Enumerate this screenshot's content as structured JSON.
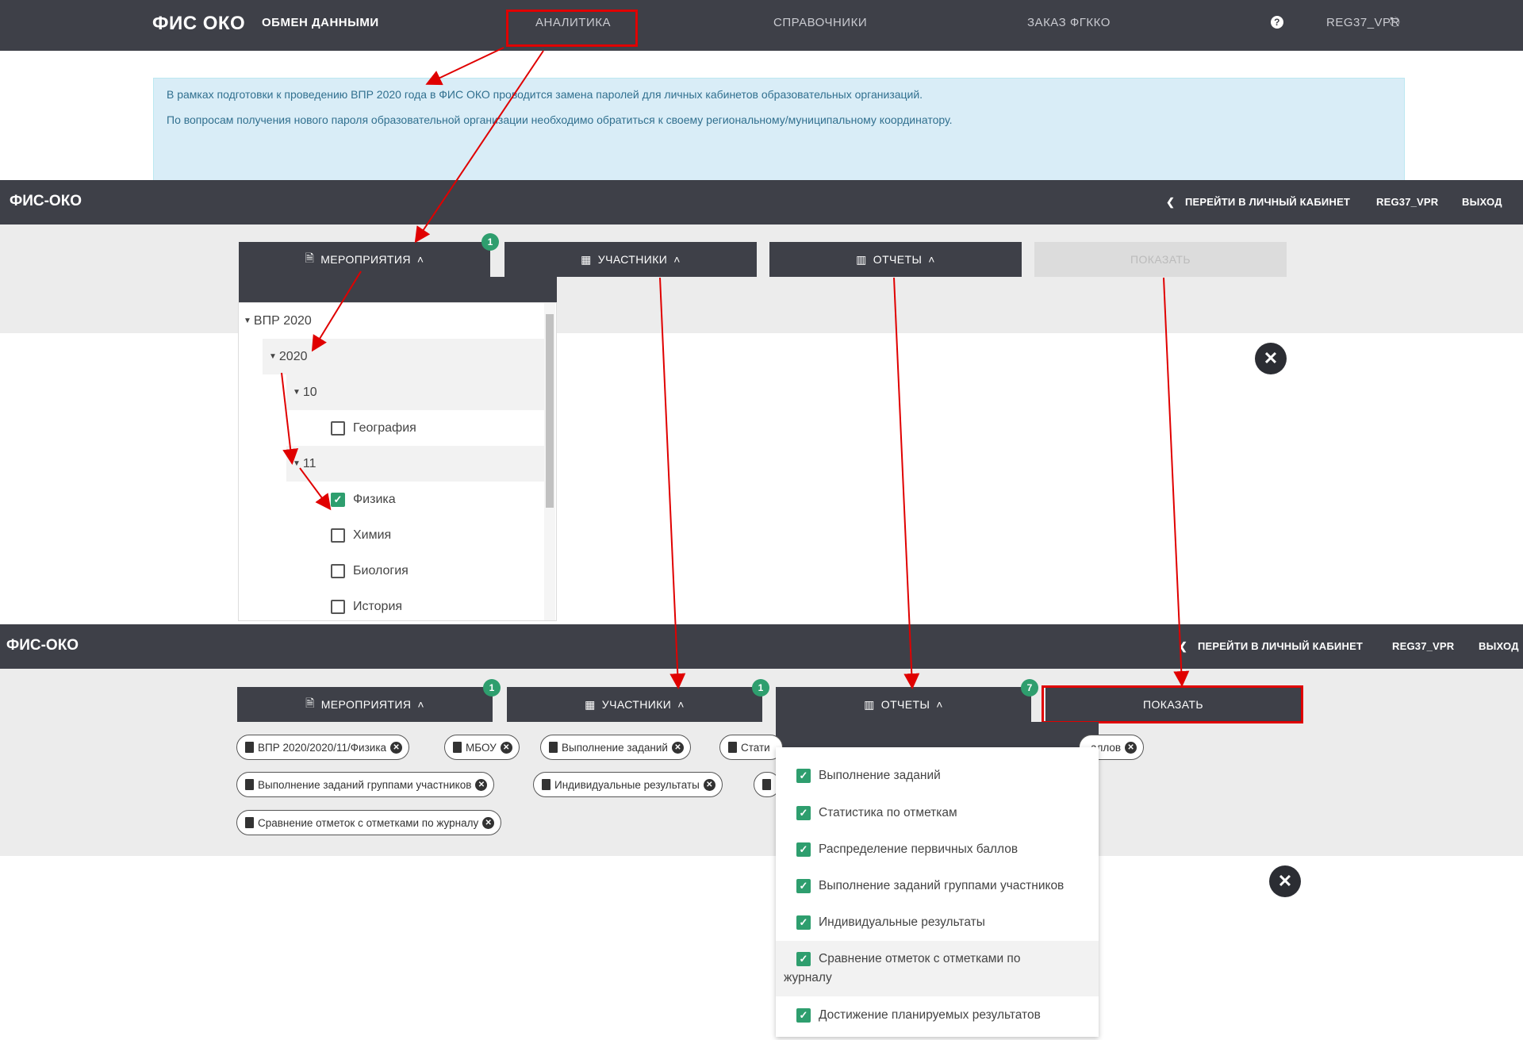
{
  "top_nav": {
    "brand": "ФИС ОКО",
    "items": [
      "ОБМЕН ДАННЫМИ",
      "АНАЛИТИКА",
      "СПРАВОЧНИКИ",
      "ЗАКАЗ ФГККО"
    ],
    "user": "REG37_VPR",
    "help_icon": "question-circle-icon",
    "logout_icon": "logout-icon"
  },
  "alert": {
    "line1": "В рамках подготовки к проведению ВПР 2020 года в ФИС ОКО проводится замена паролей для личных кабинетов образовательных организаций.",
    "line2": "По вопросам получения нового пароля образовательной организации необходимо обратиться к своему региональному/муниципальному координатору."
  },
  "header": {
    "logo": "ФИС-ОКО",
    "cabinet_link": "ПЕРЕЙТИ В ЛИЧНЫЙ КАБИНЕТ",
    "user": "REG37_VPR",
    "logout": "ВЫХОД"
  },
  "tabs": {
    "events": "МЕРОПРИЯТИЯ",
    "participants": "УЧАСТНИКИ",
    "reports": "ОТЧЕТЫ",
    "show": "ПОКАЗАТЬ"
  },
  "panel1": {
    "events_badge": "1",
    "tree": [
      {
        "label": "ВПР 2020",
        "type": "node"
      },
      {
        "label": "2020",
        "type": "node"
      },
      {
        "label": "10",
        "type": "node"
      },
      {
        "label": "География",
        "type": "leaf",
        "checked": false
      },
      {
        "label": "11",
        "type": "node"
      },
      {
        "label": "Физика",
        "type": "leaf",
        "checked": true
      },
      {
        "label": "Химия",
        "type": "leaf",
        "checked": false
      },
      {
        "label": "Биология",
        "type": "leaf",
        "checked": false
      },
      {
        "label": "История",
        "type": "leaf",
        "checked": false
      }
    ]
  },
  "panel2": {
    "events_badge": "1",
    "participants_badge": "1",
    "reports_badge": "7",
    "chips": {
      "row1": [
        "ВПР 2020/2020/11/Физика",
        "МБОУ",
        "Выполнение заданий",
        "Стати",
        "аллов"
      ],
      "row2": [
        "Выполнение заданий группами участников",
        "Индивидуальные результаты"
      ],
      "row3": [
        "Сравнение отметок с отметками по журналу"
      ]
    },
    "reports": [
      "Выполнение заданий",
      "Статистика по отметкам",
      "Распределение первичных баллов",
      "Выполнение заданий группами участников",
      "Индивидуальные результаты",
      "Сравнение отметок с отметками по",
      "журналу",
      "Достижение планируемых результатов"
    ]
  },
  "colors": {
    "dark_bar": "#3e4048",
    "accent_green": "#2e9e6e",
    "highlight_red": "#e00000",
    "alert_bg": "#d9edf7"
  }
}
